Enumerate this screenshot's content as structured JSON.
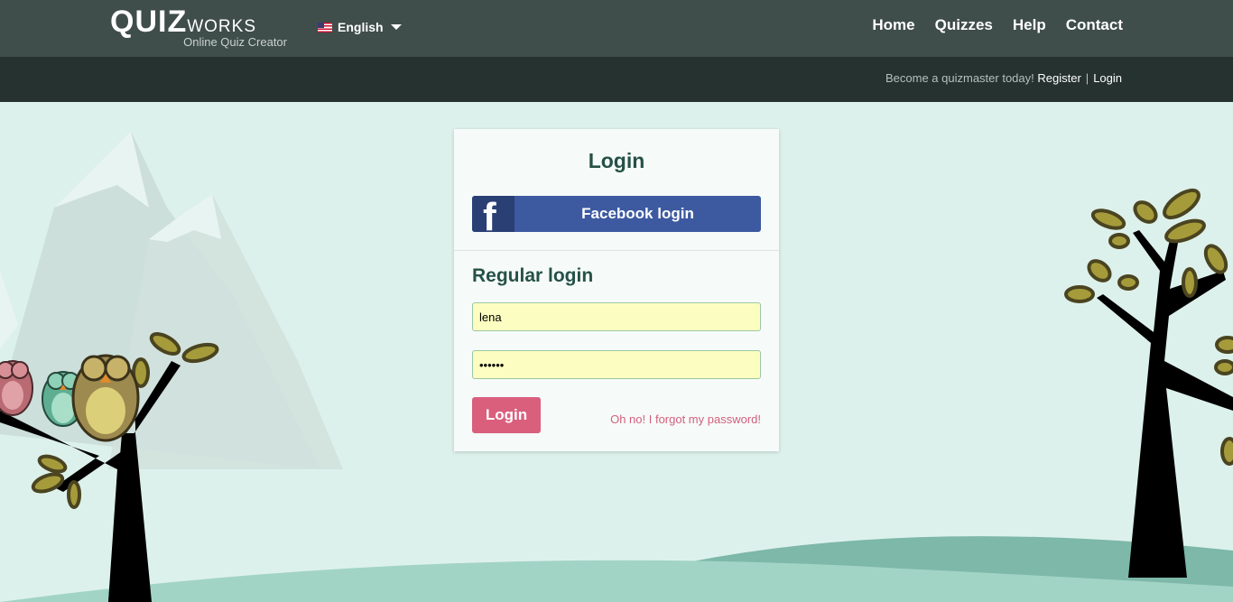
{
  "header": {
    "logo_main": "QUIZ",
    "logo_small": "WORKS",
    "logo_subtitle": "Online Quiz Creator",
    "language": "English",
    "nav": [
      "Home",
      "Quizzes",
      "Help",
      "Contact"
    ]
  },
  "subnav": {
    "promo": "Become a quizmaster today!",
    "register": "Register",
    "separator": "|",
    "login": "Login"
  },
  "login_card": {
    "title": "Login",
    "facebook_icon": "f",
    "facebook_label": "Facebook login",
    "regular_title": "Regular login",
    "username_value": "lena",
    "password_value": "••••••",
    "submit_label": "Login",
    "forgot_label": "Oh no! I forgot my password!"
  },
  "colors": {
    "header_bg": "#3f4d4b",
    "subheader_bg": "#263230",
    "page_bg": "#ddf1ec",
    "heading": "#265147",
    "facebook": "#3d5aa0",
    "login_button": "#d95f7d",
    "input_bg": "#fbfec0"
  },
  "icons": {
    "language_flag": "us-flag-icon",
    "dropdown": "caret-down-icon",
    "facebook": "facebook-icon"
  }
}
